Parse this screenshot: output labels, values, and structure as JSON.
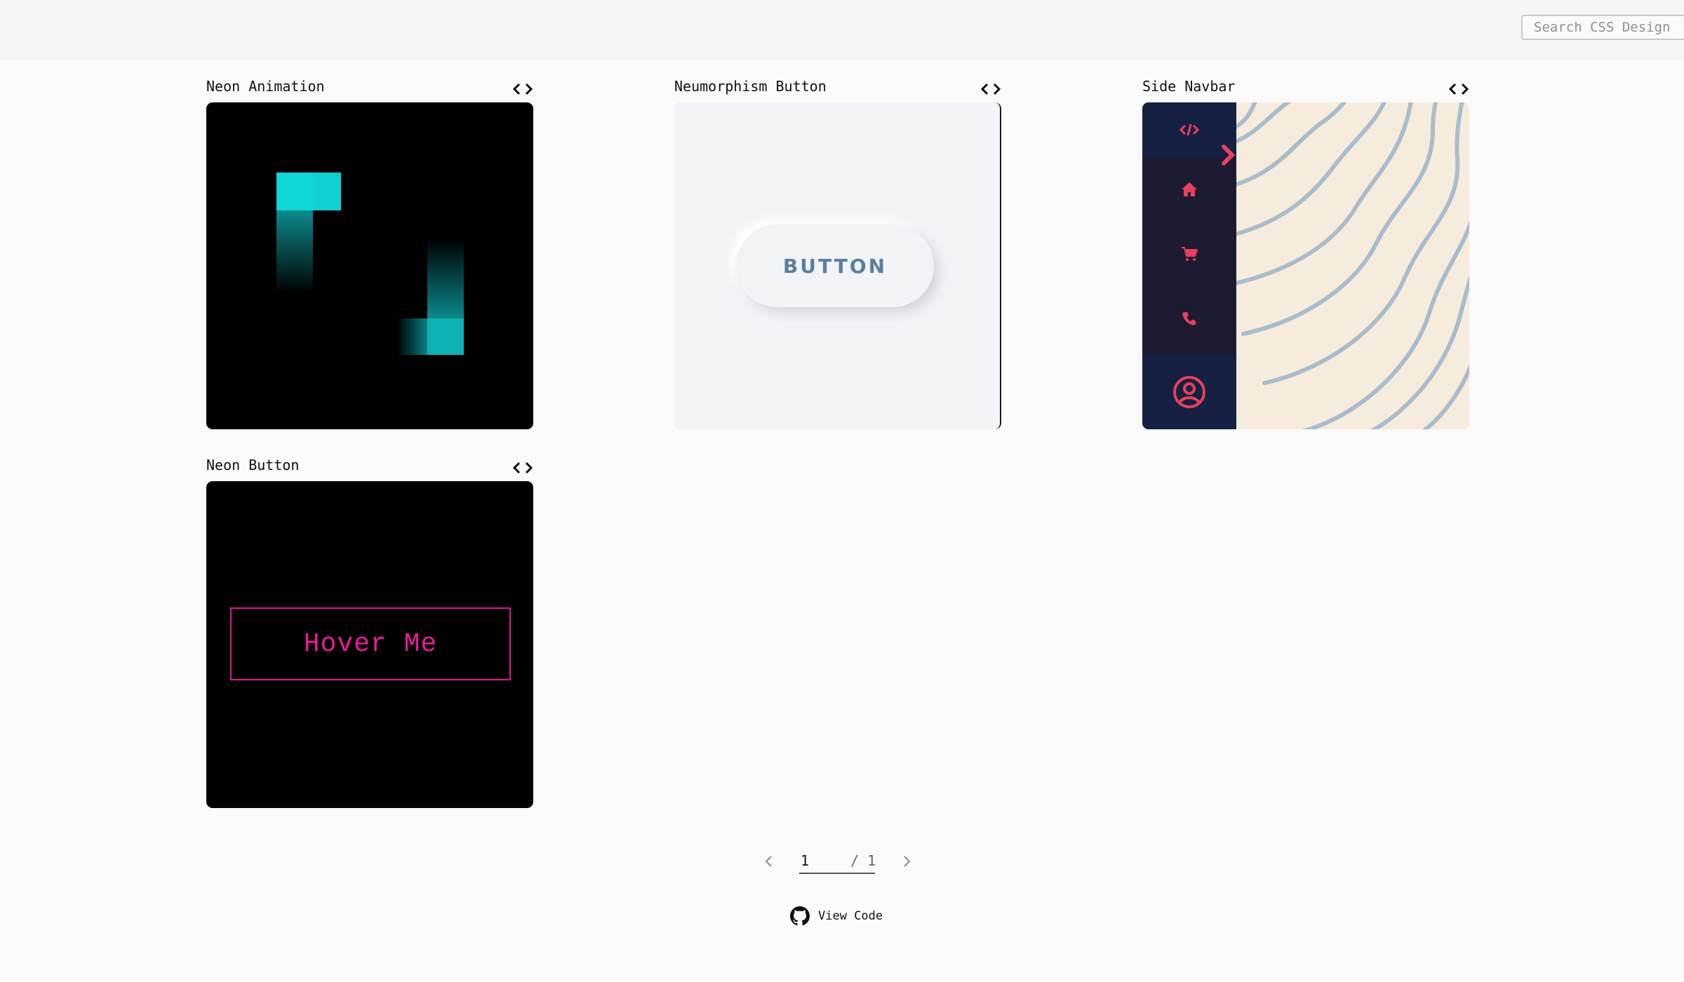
{
  "header": {
    "search_placeholder": "Search CSS Design"
  },
  "cards": [
    {
      "title": "Neon Animation",
      "code_icon": "code-icon"
    },
    {
      "title": "Neumorphism Button",
      "code_icon": "code-icon",
      "button_label": "BUTTON"
    },
    {
      "title": "Side Navbar",
      "code_icon": "code-icon",
      "nav_icons": [
        "code-icon",
        "home-icon",
        "cart-icon",
        "phone-icon",
        "user-icon"
      ]
    },
    {
      "title": "Neon Button",
      "code_icon": "code-icon",
      "button_label": "Hover Me"
    }
  ],
  "pagination": {
    "current": "1",
    "total": "/ 1"
  },
  "footer": {
    "view_code_label": "View Code",
    "icon": "github-icon"
  },
  "colors": {
    "neon_cyan": "#0fd6d9",
    "neon_pink": "#ec1a96",
    "navbar_dark": "#1c1b31",
    "navbar_accent": "#e8405c",
    "neumorph_text": "#5b7f9f",
    "pattern_bg": "#f6ecdd",
    "pattern_line": "#a9bccb"
  }
}
